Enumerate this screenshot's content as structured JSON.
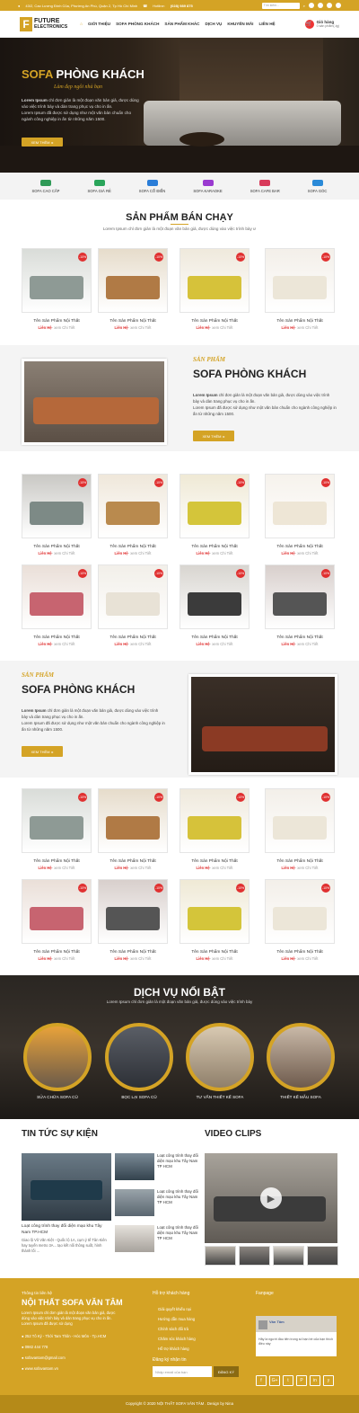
{
  "topbar": {
    "address": "43/2, Cao Lương Đình Của, Phường An Phú, Quận 2, Tp Hồ Chí Minh",
    "hotline_label": "Hotline:",
    "hotline": "(028) 989 875",
    "search_placeholder": "Tìm kiếm..."
  },
  "logo": {
    "mark": "F",
    "line1": "FUTURE",
    "line2": "ELECTRONICS"
  },
  "nav": [
    "GIỚI THIỆU",
    "SOFA PHÒNG KHÁCH",
    "SẢN PHẨM KHÁC",
    "DỊCH VỤ",
    "KHUYẾN MÃI",
    "LIÊN HỆ"
  ],
  "cart": {
    "title": "Giỏ hàng",
    "count": "0 sản phẩm(-tg)"
  },
  "hero": {
    "title_a": "SOFA",
    "title_b": "PHÒNG KHÁCH",
    "subtitle": "Làm đẹp ngôi nhà bạn",
    "p1_bold": "Lorem Ipsum",
    "p1": " chỉ đơn giản là một đoạn văn bản giả, được dùng vào việc trình bày và dàn trang phục vụ cho in ấn.",
    "p2": "Lorem Ipsum đã được sử dụng như một văn bản chuẩn cho ngành công nghiệp in ấn từ những năm 1500.",
    "button": "XEM THÊM"
  },
  "categories": [
    {
      "label": "SOFA CAO CẤP",
      "color": "#2f9a57"
    },
    {
      "label": "SOFA GIÁ RẺ",
      "color": "#2aa55a"
    },
    {
      "label": "SOFA CỔ ĐIỂN",
      "color": "#2a7dd8"
    },
    {
      "label": "SOFA KARAOKE",
      "color": "#9a3ad0"
    },
    {
      "label": "SOFA CAFE BAR",
      "color": "#d83a5a"
    },
    {
      "label": "SOFA GÓC",
      "color": "#2a8ad8"
    }
  ],
  "best": {
    "title": "SẢN PHẨM BÁN CHẠY",
    "sub": "Lorem Ipsum chỉ đơn giản là một đoạn văn bản giả, được dùng vào việc trình bày ư"
  },
  "product": {
    "name": "Tên Sản Phẩm Nội Thất",
    "price": "Liên Hệ",
    "detail": "- xem Chi Tiết",
    "badge": "-10%"
  },
  "feature": {
    "small": "SẢN PHẨM",
    "big": "SOFA PHÒNG KHÁCH",
    "p1_bold": "Lorem Ipsum",
    "p1": " chỉ đơn giản là một đoạn văn bản giả, được dùng vào việc trình bày và dàn trang phục vụ cho in ấn.",
    "p2": "Lorem Ipsum đã được sử dụng như một văn bản chuẩn cho ngành công nghiệp in ấn từ những năm 1500.",
    "button": "XEM THÊM"
  },
  "services": {
    "title": "DỊCH VỤ NỔI BẬT",
    "sub": "Lorem Ipsum chỉ đơn giản là một đoạn văn bản giả, được dùng vào việc trình bày",
    "items": [
      "SỬA CHỮA SOFA CŨ",
      "BỌC LẠI SOFA CŨ",
      "TƯ VẤN THIẾT KẾ SOFA",
      "THIẾT KẾ MẪU SOFA"
    ]
  },
  "news": {
    "title": "TIN TỨC SỰ KIỆN",
    "main_title": "Loạt công trình thay đổi diện mạo khu Tây Nam TP.HCM",
    "main_desc": "Giao lộ Võ Văn Kiệt - Quốc lộ 1A, cụm ý tế Tân Kiên hay tuyến metro 3A... tạo kết nối thông suốt, hình thành lối ...",
    "small_title": "Loạt công trình thay đổi diện mạo khu Tây Nam TP HCM"
  },
  "video": {
    "title": "VIDEO CLIPS"
  },
  "footer": {
    "brand_small": "Thông tin liên hệ",
    "brand": "NỘI THẤT SOFA VĂN TÂM",
    "desc": "Lorem Ipsum chỉ đơn giản là một đoạn văn bản giả, được dùng vào việc trình bày và dàn trang phục vụ cho in ấn. Lorem Ipsum đã được sử dụng",
    "address": "252 Tô Ký - Thới Tam Thôn - Hóc Môn - Tp.HCM",
    "phone": "0982 444 778",
    "email": "sofavantam@gmail.com",
    "web": "www.sofavantam.vn",
    "support_title": "Hỗ trợ khách hàng",
    "support": [
      "Giải quyết khiếu nại",
      "Hướng dẫn mua hàng",
      "Chính sách đổi trả",
      "Chăm sóc khách hàng",
      "Hỗ trợ khách hàng"
    ],
    "newsletter_title": "Đăng ký nhận tin",
    "newsletter_placeholder": "Nhập email của bạn",
    "newsletter_button": "ĐĂNG KÝ",
    "fanpage_title": "Fanpage",
    "fb_name": "Vân Tâm",
    "fb_text": "Hãy là người đầu tiên trong số bạn bè của bạn thích điều này",
    "socials": [
      "f",
      "G+",
      "t",
      "P",
      "in",
      "y"
    ]
  },
  "copyright": "Copyright © 2020 NỘI THẤT SOFA VĂN TÂM . Design by Nina"
}
